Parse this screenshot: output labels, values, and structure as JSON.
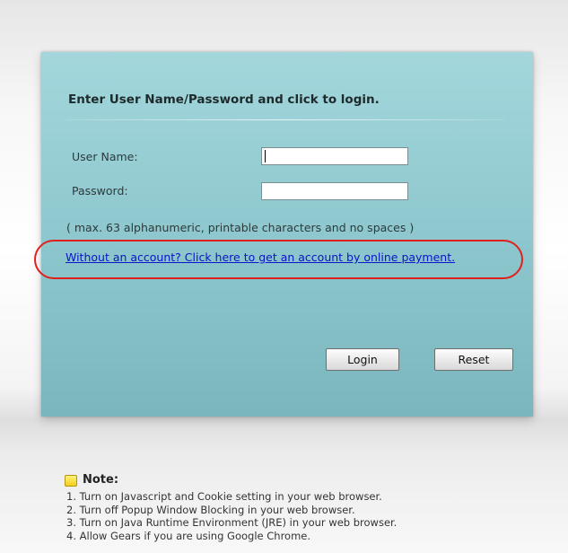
{
  "login": {
    "title": "Enter User Name/Password and click to login.",
    "username_label": "User Name:",
    "username_value": "",
    "password_label": "Password:",
    "password_value": "",
    "hint": "( max. 63 alphanumeric, printable characters and no spaces )",
    "account_link": "Without an account? Click here to get an account by online payment.",
    "login_button": "Login",
    "reset_button": "Reset"
  },
  "note": {
    "heading": "Note:",
    "items": [
      "1. Turn on Javascript and Cookie setting in your web browser.",
      "2. Turn off Popup Window Blocking in your web browser.",
      "3. Turn on Java Runtime Environment (JRE) in your web browser.",
      "4. Allow Gears if you are using Google Chrome."
    ]
  },
  "colors": {
    "panel": "#94ccd2",
    "link": "#0a14c8",
    "highlight_ring": "#e0201c",
    "note_icon": "#f3cf1c"
  },
  "icons": {
    "note": "note-icon"
  }
}
